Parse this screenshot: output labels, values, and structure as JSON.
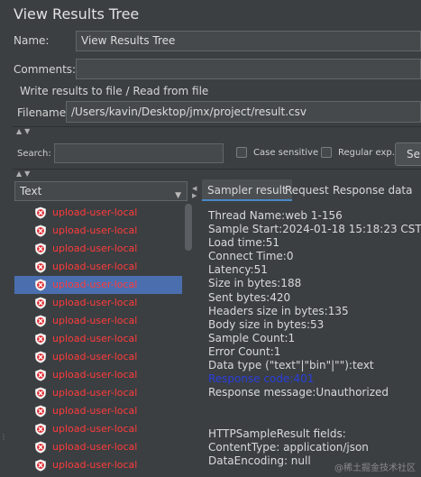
{
  "title": "View Results Tree",
  "name": {
    "label": "Name:",
    "value": "View Results Tree"
  },
  "comments": {
    "label": "Comments:",
    "value": ""
  },
  "write_results": {
    "legend": "Write results to file / Read from file",
    "filename_label": "Filename",
    "filename_value": "/Users/kavin/Desktop/jmx/project/result.csv"
  },
  "search": {
    "label": "Search:",
    "value": "",
    "case_sensitive": "Case sensitive",
    "regular_exp": "Regular exp.",
    "button": "Se"
  },
  "renderer": {
    "selected": "Text"
  },
  "tree": {
    "items": [
      {
        "label": "upload-user-local"
      },
      {
        "label": "upload-user-local"
      },
      {
        "label": "upload-user-local"
      },
      {
        "label": "upload-user-local"
      },
      {
        "label": "upload-user-local"
      },
      {
        "label": "upload-user-local"
      },
      {
        "label": "upload-user-local"
      },
      {
        "label": "upload-user-local"
      },
      {
        "label": "upload-user-local"
      },
      {
        "label": "upload-user-local"
      },
      {
        "label": "upload-user-local"
      },
      {
        "label": "upload-user-local"
      },
      {
        "label": "upload-user-local"
      },
      {
        "label": "upload-user-local"
      },
      {
        "label": "upload-user-local"
      }
    ],
    "selected_index": 4
  },
  "tabs": [
    "Sampler result",
    "Request",
    "Response data"
  ],
  "sampler_result": {
    "line1": "Thread Name:web 1-156",
    "line2": "Sample Start:2024-01-18 15:18:23 CST",
    "line3": "Load time:51",
    "line4": "Connect Time:0",
    "line5": "Latency:51",
    "line6": "Size in bytes:188",
    "line7": "Sent bytes:420",
    "line8": "Headers size in bytes:135",
    "line9": "Body size in bytes:53",
    "line10": "Sample Count:1",
    "line11": "Error Count:1",
    "line12": "Data type (\"text\"|\"bin\"|\"\"):text",
    "line13": "Response code:401",
    "line14": "Response message:Unauthorized",
    "line15": "",
    "line16": "",
    "line17": "HTTPSampleResult fields:",
    "line18": "ContentType: application/json",
    "line19": "DataEncoding: null"
  },
  "watermark": "@稀土掘金技术社区",
  "colors": {
    "error_text": "#ff3b3b",
    "selection": "#4b6eaf",
    "link": "#2a3fdc"
  }
}
